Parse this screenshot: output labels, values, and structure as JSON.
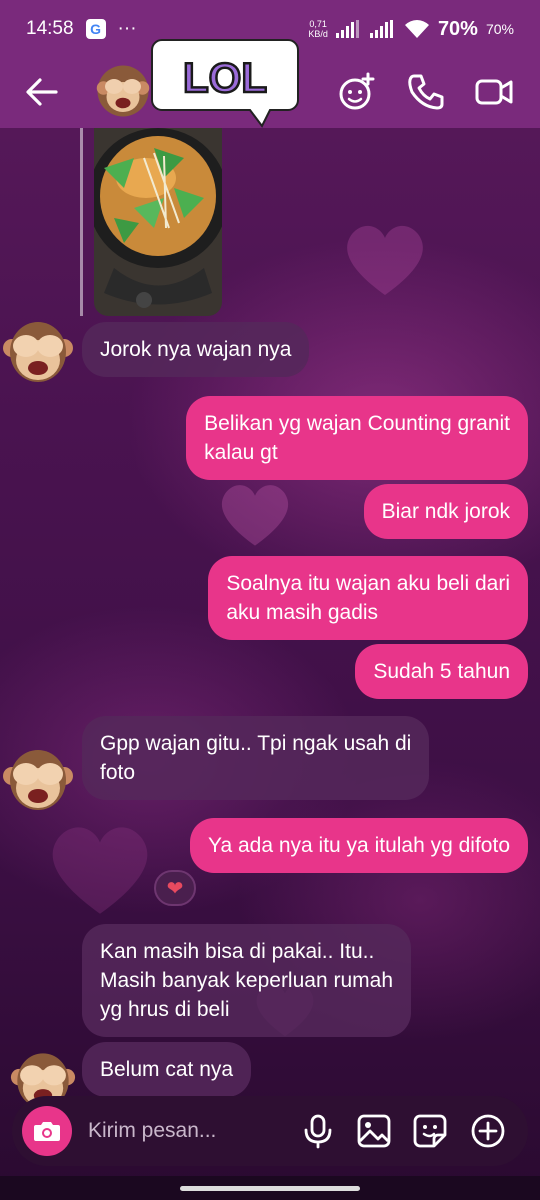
{
  "status_bar": {
    "time": "14:58",
    "google_badge": "G",
    "more": "···",
    "net_speed_value": "0,71",
    "net_speed_unit": "KB/d",
    "battery_pct": "70%",
    "battery_pct_small": "70%"
  },
  "header": {
    "sticker_text": "LOL",
    "back_icon": "arrow-left-icon",
    "effects_icon": "face-sparkle-icon",
    "call_icon": "phone-icon",
    "video_icon": "video-camera-icon"
  },
  "messages": [
    {
      "side": "in",
      "text": "Jorok nya wajan nya",
      "avatar": "see-no-evil-monkey"
    },
    {
      "side": "out",
      "text": "Belikan yg wajan Counting granit\nkalau gt"
    },
    {
      "side": "out",
      "text": "Biar ndk jorok"
    },
    {
      "side": "out",
      "text": "Soalnya itu wajan aku beli dari\naku masih gadis"
    },
    {
      "side": "out",
      "text": "Sudah 5 tahun"
    },
    {
      "side": "in",
      "text": "Gpp wajan gitu.. Tpi ngak usah di\nfoto",
      "avatar": "see-no-evil-monkey"
    },
    {
      "side": "out",
      "text": "Ya ada nya itu ya itulah yg difoto",
      "reaction": "❤"
    },
    {
      "side": "in",
      "text": "Kan masih bisa di pakai.. Itu..\nMasih banyak keperluan rumah\nyg hrus di beli"
    },
    {
      "side": "in",
      "text": "Belum cat nya",
      "avatar": "see-no-evil-monkey"
    }
  ],
  "composer": {
    "placeholder": "Kirim pesan...",
    "icons": [
      "camera-icon",
      "microphone-icon",
      "gallery-icon",
      "sticker-icon",
      "plus-icon"
    ]
  },
  "colors": {
    "header_bg": "#7a2a7c",
    "outgoing_bubble": "#e8358a",
    "incoming_bubble": "#55285a"
  }
}
